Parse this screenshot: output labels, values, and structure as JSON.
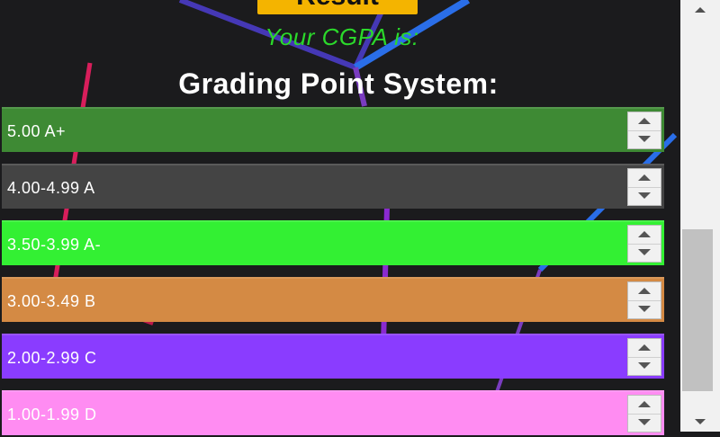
{
  "result_button": {
    "label": "Result"
  },
  "cgpa_text": "Your CGPA is:",
  "heading": "Grading Point System:",
  "grades": [
    {
      "label": "5.00 A+",
      "color": "#3e8a34"
    },
    {
      "label": "4.00-4.99 A",
      "color": "#444444"
    },
    {
      "label": "3.50-3.99 A-",
      "color": "#33f033"
    },
    {
      "label": "3.00-3.49 B",
      "color": "#d48a44"
    },
    {
      "label": "2.00-2.99 C",
      "color": "#8a3cff"
    },
    {
      "label": "1.00-1.99 D",
      "color": "#ff8cf2"
    }
  ],
  "colors": {
    "background": "#1b1b1d",
    "cgpa_text": "#2bd92b",
    "result_button": "#f4b400",
    "heading": "#ffffff"
  }
}
